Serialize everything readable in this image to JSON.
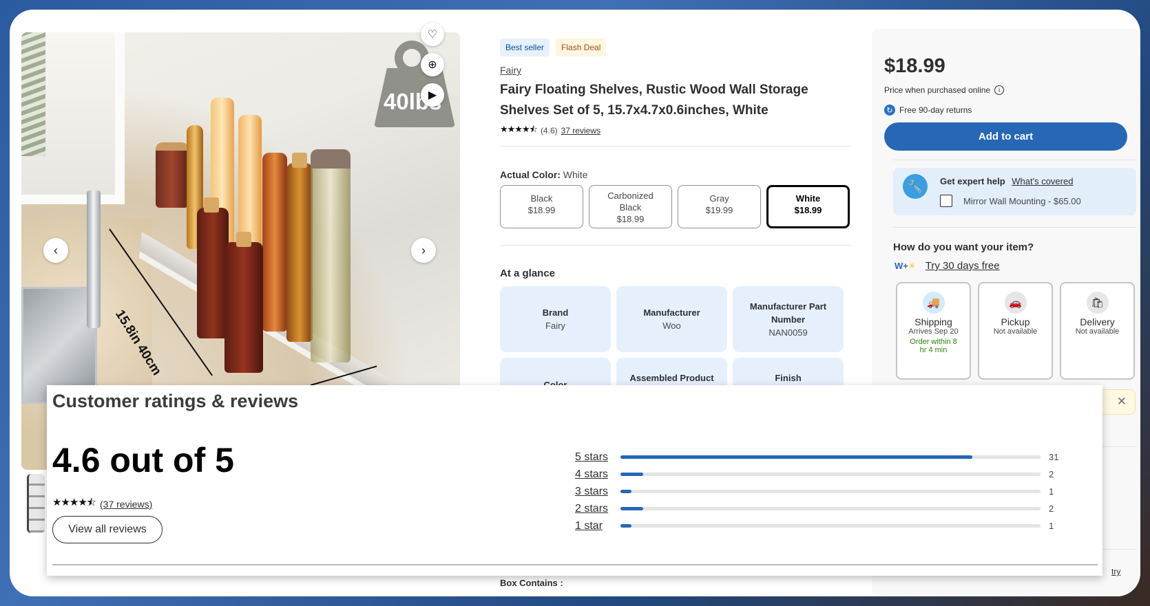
{
  "gallery": {
    "weight_label": "40lbs",
    "dimension_label": "15.8in 40cm",
    "icons": [
      "heart-icon",
      "zoom-in-icon",
      "play-icon",
      "chevron-left-icon",
      "chevron-right-icon"
    ]
  },
  "product": {
    "badges": [
      "Best seller",
      "Flash Deal"
    ],
    "brand": "Fairy",
    "title": "Fairy Floating Shelves, Rustic Wood Wall Storage Shelves Set of 5, 15.7x4.7x0.6inches, White",
    "stars": "★★★★⯪",
    "rating_text": "(4.6)",
    "reviews_link": "37 reviews"
  },
  "color": {
    "label": "Actual Color:",
    "value": "White",
    "options": [
      {
        "name": "Black",
        "price": "$18.99",
        "selected": false
      },
      {
        "name": "Carbonized Black",
        "price": "$18.99",
        "selected": false
      },
      {
        "name": "Gray",
        "price": "$19.99",
        "selected": false
      },
      {
        "name": "White",
        "price": "$18.99",
        "selected": true
      }
    ]
  },
  "glance": {
    "title": "At a glance",
    "items": [
      {
        "key": "Brand",
        "value": "Fairy"
      },
      {
        "key": "Manufacturer",
        "value": "Woo"
      },
      {
        "key": "Manufacturer Part Number",
        "value": "NAN0059"
      },
      {
        "key": "Color",
        "value": ""
      },
      {
        "key": "Assembled Product",
        "value": ""
      },
      {
        "key": "Finish",
        "value": ""
      }
    ]
  },
  "box_contains": "Box Contains :",
  "buybox": {
    "price": "$18.99",
    "price_note": "Price when purchased online",
    "returns": "Free 90-day returns",
    "add_to_cart": "Add to cart",
    "expert_title": "Get expert help",
    "expert_link": "What's covered",
    "expert_option": "Mirror Wall Mounting - $65.00",
    "how_title": "How do you want your item?",
    "wplus_logo": "W+",
    "wplus_link": "Try 30 days free",
    "fulfillment": [
      {
        "name": "Shipping",
        "sub": "Arrives Sep 20",
        "note": "Order within 8 hr 4 min"
      },
      {
        "name": "Pickup",
        "sub": "Not available",
        "note": ""
      },
      {
        "name": "Delivery",
        "sub": "Not available",
        "note": ""
      }
    ],
    "bottom_link": "try"
  },
  "reviews": {
    "title": "Customer ratings & reviews",
    "score": "4.6 out of 5",
    "stars": "★★★★⯪",
    "count_link": "(37 reviews)",
    "view_all": "View all reviews",
    "distribution": [
      {
        "label": "5 stars",
        "count": 31,
        "total": 37
      },
      {
        "label": "4 stars",
        "count": 2,
        "total": 37
      },
      {
        "label": "3 stars",
        "count": 1,
        "total": 37
      },
      {
        "label": "2 stars",
        "count": 2,
        "total": 37
      },
      {
        "label": "1 star",
        "count": 1,
        "total": 37
      }
    ]
  },
  "colors": {
    "accent": "#2667b6",
    "glance_bg": "#e6f0fc",
    "success": "#2a8703"
  }
}
